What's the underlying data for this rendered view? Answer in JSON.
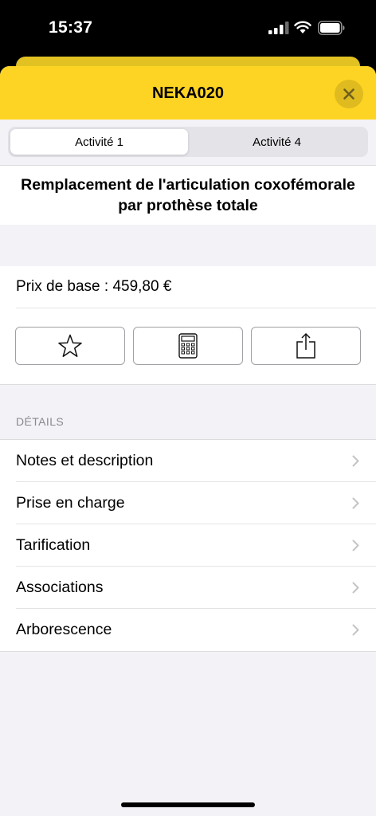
{
  "status_bar": {
    "time": "15:37"
  },
  "sheet": {
    "title": "NEKA020",
    "close_icon": "close-icon"
  },
  "tabs": [
    {
      "label": "Activité 1",
      "selected": true
    },
    {
      "label": "Activité 4",
      "selected": false
    }
  ],
  "act": {
    "title": "Remplacement de l'articulation coxofémorale par prothèse totale",
    "price": "Prix de base : 459,80 €"
  },
  "actions": [
    {
      "icon": "star-icon"
    },
    {
      "icon": "calculator-icon"
    },
    {
      "icon": "share-icon"
    }
  ],
  "details": {
    "header": "DÉTAILS",
    "items": [
      {
        "label": "Notes et description"
      },
      {
        "label": "Prise en charge"
      },
      {
        "label": "Tarification"
      },
      {
        "label": "Associations"
      },
      {
        "label": "Arborescence"
      }
    ]
  },
  "colors": {
    "accent_yellow": "#fdd423",
    "background": "#f2f2f7"
  }
}
